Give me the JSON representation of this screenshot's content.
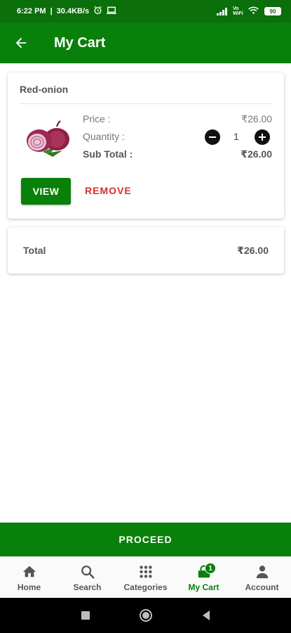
{
  "status_bar": {
    "time": "6:22 PM",
    "speed": "30.4KB/s",
    "network": "Vo WiFi",
    "battery": "90"
  },
  "app_bar": {
    "title": "My Cart"
  },
  "cart_item": {
    "name": "Red-onion",
    "price_label": "Price :",
    "price_value": "₹26.00",
    "quantity_label": "Quantity :",
    "quantity_value": "1",
    "subtotal_label": "Sub Total :",
    "subtotal_value": "₹26.00",
    "view_label": "VIEW",
    "remove_label": "REMOVE"
  },
  "total": {
    "label": "Total",
    "value": "₹26.00"
  },
  "proceed_label": "PROCEED",
  "bottom_nav": {
    "items": [
      {
        "label": "Home",
        "icon": "home-icon"
      },
      {
        "label": "Search",
        "icon": "search-icon"
      },
      {
        "label": "Categories",
        "icon": "grid-icon"
      },
      {
        "label": "My Cart",
        "icon": "cart-icon",
        "badge": "1",
        "active": true
      },
      {
        "label": "Account",
        "icon": "person-icon"
      }
    ]
  },
  "colors": {
    "primary": "#098009",
    "status_bar": "#0b6f0b",
    "remove": "#d32f2f"
  }
}
